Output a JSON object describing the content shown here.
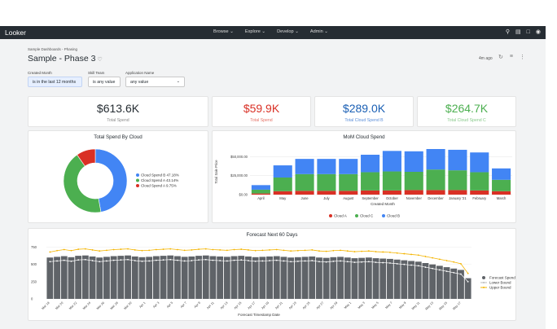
{
  "app": {
    "logo": "Looker"
  },
  "nav": {
    "items": [
      "Browse ⌄",
      "Explore ⌄",
      "Develop ⌄",
      "Admin ⌄"
    ]
  },
  "header": {
    "breadcrumb": "Sample Dashboards - Phasing",
    "title": "Sample - Phase 3",
    "updated": "4m ago"
  },
  "filters": [
    {
      "label": "Created Month",
      "value": "is in the last 12 months"
    },
    {
      "label": "Skill Team",
      "value": "is any value"
    },
    {
      "label": "Application Name",
      "value": "any value"
    }
  ],
  "kpis": [
    {
      "value": "$613.6K",
      "label": "Total Spend",
      "color": "#262d33",
      "label_color": "#8a8a8a"
    },
    {
      "value": "$59.9K",
      "label": "Total Spend",
      "color": "#d93025",
      "label_color": "#e57368"
    },
    {
      "value": "$289.0K",
      "label": "Total Cloud Spend B",
      "color": "#1a5fb4",
      "label_color": "#5d8fd9"
    },
    {
      "value": "$264.7K",
      "label": "Total Cloud Spend C",
      "color": "#4caf50",
      "label_color": "#88c98b"
    }
  ],
  "colors": {
    "cloud_a": "#d93025",
    "cloud_b": "#4285f4",
    "cloud_c": "#4caf50",
    "forecast": "#5f6368",
    "upper": "#f4b400",
    "lower": "#ffffff"
  },
  "chart_data": [
    {
      "type": "pie",
      "title": "Total Spend By Cloud",
      "donut": true,
      "slices": [
        {
          "name": "Cloud Spend B 47.18%",
          "value": 47.18,
          "color": "#4285f4"
        },
        {
          "name": "Cloud Spend A 43.14%",
          "value": 43.14,
          "color": "#4caf50"
        },
        {
          "name": "Cloud Spend A 9.75%",
          "value": 9.75,
          "color": "#d93025"
        }
      ],
      "legend": "right"
    },
    {
      "type": "bar",
      "title": "MoM Cloud Spend",
      "stacked": true,
      "ylabel": "Total Sale Price",
      "xlabel": "Created Month",
      "yticks": [
        "$0.00",
        "$25,000.00",
        "$50,000.00"
      ],
      "ylim": [
        0,
        60000
      ],
      "categories": [
        "April",
        "May",
        "June",
        "July",
        "August",
        "September",
        "October",
        "November",
        "December",
        "January '21",
        "February",
        "March"
      ],
      "series": [
        {
          "name": "Cloud A",
          "color": "#d93025",
          "values": [
            1500,
            4500,
            5000,
            5000,
            5000,
            5500,
            5500,
            6000,
            6000,
            6000,
            5500,
            4500
          ]
        },
        {
          "name": "Cloud C",
          "color": "#4caf50",
          "values": [
            5000,
            18000,
            22000,
            22000,
            22000,
            24000,
            25000,
            24000,
            27000,
            26000,
            24000,
            15000
          ]
        },
        {
          "name": "Cloud B",
          "color": "#4285f4",
          "values": [
            6000,
            16000,
            20000,
            20000,
            20000,
            23000,
            27000,
            27000,
            27000,
            27000,
            26000,
            15000
          ]
        }
      ],
      "legend": "bottom"
    },
    {
      "type": "bar",
      "title": "Forecast Next 60 Days",
      "xlabel": "Forecast Timestamp Date",
      "yticks": [
        "0",
        "250",
        "500",
        "750"
      ],
      "ylim": [
        0,
        780
      ],
      "x": [
        "Mar 18",
        "Mar 20",
        "Mar 22",
        "Mar 24",
        "Mar 26",
        "Mar 28",
        "Mar 30",
        "Apr 1",
        "Apr 3",
        "Apr 5",
        "Apr 7",
        "Apr 9",
        "Apr 11",
        "Apr 13",
        "Apr 15",
        "Apr 17",
        "Apr 19",
        "Apr 21",
        "Apr 23",
        "Apr 25",
        "Apr 27",
        "Apr 29",
        "May 1",
        "May 3",
        "May 5",
        "May 7",
        "May 9",
        "May 11",
        "May 13",
        "May 15",
        "May 17"
      ],
      "series": [
        {
          "name": "Forecast Spend",
          "color": "#5f6368",
          "kind": "bar",
          "values": [
            600,
            610,
            620,
            605,
            625,
            630,
            615,
            600,
            610,
            620,
            625,
            630,
            615,
            605,
            610,
            620,
            625,
            630,
            620,
            610,
            615,
            625,
            630,
            620,
            615,
            610,
            620,
            625,
            615,
            605,
            610,
            615,
            620,
            610,
            600,
            605,
            610,
            615,
            600,
            595,
            605,
            610,
            600,
            590,
            595,
            600,
            590,
            585,
            580,
            570,
            560,
            550,
            540,
            520,
            500,
            480,
            460,
            440,
            420,
            300
          ]
        },
        {
          "name": "Lower Bound",
          "color": "#ffffff",
          "kind": "line",
          "values": [
            540,
            550,
            560,
            545,
            565,
            570,
            555,
            540,
            550,
            560,
            565,
            570,
            555,
            545,
            550,
            560,
            565,
            570,
            560,
            550,
            555,
            565,
            570,
            560,
            555,
            550,
            560,
            565,
            555,
            545,
            550,
            555,
            560,
            550,
            540,
            545,
            550,
            555,
            540,
            535,
            545,
            550,
            540,
            530,
            535,
            540,
            530,
            525,
            520,
            510,
            500,
            490,
            480,
            460,
            440,
            420,
            400,
            380,
            360,
            250
          ]
        },
        {
          "name": "Upper Bound",
          "color": "#f4b400",
          "kind": "line",
          "values": [
            680,
            700,
            715,
            700,
            720,
            725,
            710,
            695,
            705,
            715,
            720,
            725,
            710,
            700,
            705,
            715,
            720,
            725,
            715,
            705,
            710,
            720,
            725,
            715,
            710,
            705,
            715,
            720,
            710,
            700,
            705,
            710,
            715,
            705,
            695,
            700,
            705,
            710,
            695,
            690,
            700,
            705,
            695,
            685,
            690,
            695,
            685,
            680,
            675,
            665,
            655,
            645,
            635,
            615,
            595,
            575,
            555,
            535,
            510,
            370
          ]
        }
      ],
      "legend": "right"
    }
  ]
}
